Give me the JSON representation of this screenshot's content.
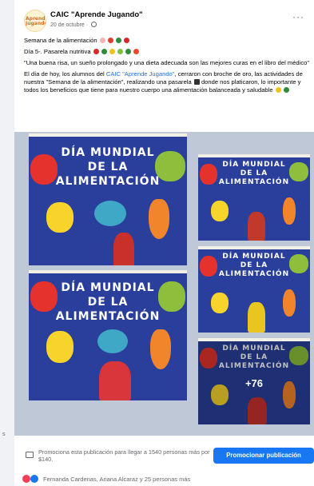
{
  "post": {
    "page_name": "CAIC \"Aprende Jugando\"",
    "avatar_text": "Aprende Jugando",
    "date": "20 de octubre",
    "more": "···",
    "lines": {
      "l1": "Semana de la alimentación",
      "l2": "Día 5-. Pasarela nutritiva",
      "l3": "\"Una buena risa, un sueño prolongado y una dieta adecuada son las mejores curas en el libro del médico\"",
      "l4_a": "El día de hoy, los alumnos del ",
      "l4_link": "CAIC \"Aprende Jugando\"",
      "l4_b": ",  cerraron con broche de oro, las actividades de nuestra \"Semana de la alimentación\", realizando una pasarela",
      "l4_c": " donde nos platicaron, lo importante y todos los beneficios que tiene para nuestro cuerpo una alimentación balanceada y saludable"
    }
  },
  "photos": {
    "banner_line1": "DÍA MUNDIAL",
    "banner_line2": "DE LA",
    "banner_line3": "ALIMENTACIÓN",
    "more_count": "+76"
  },
  "promo": {
    "text": "Promociona esta publicación para llegar a 1540 personas más por $140.",
    "button": "Promocionar publicación"
  },
  "reactions": {
    "text": "Fernanda Cardenas, Ariana Alcaraz y 25 personas más"
  },
  "sidebar": {
    "letter": "s"
  },
  "colors": {
    "accent": "#1877f2",
    "link": "#216fdb",
    "photo_bg": "#bec8d6",
    "backdrop_blue": "#2a3f9b"
  }
}
